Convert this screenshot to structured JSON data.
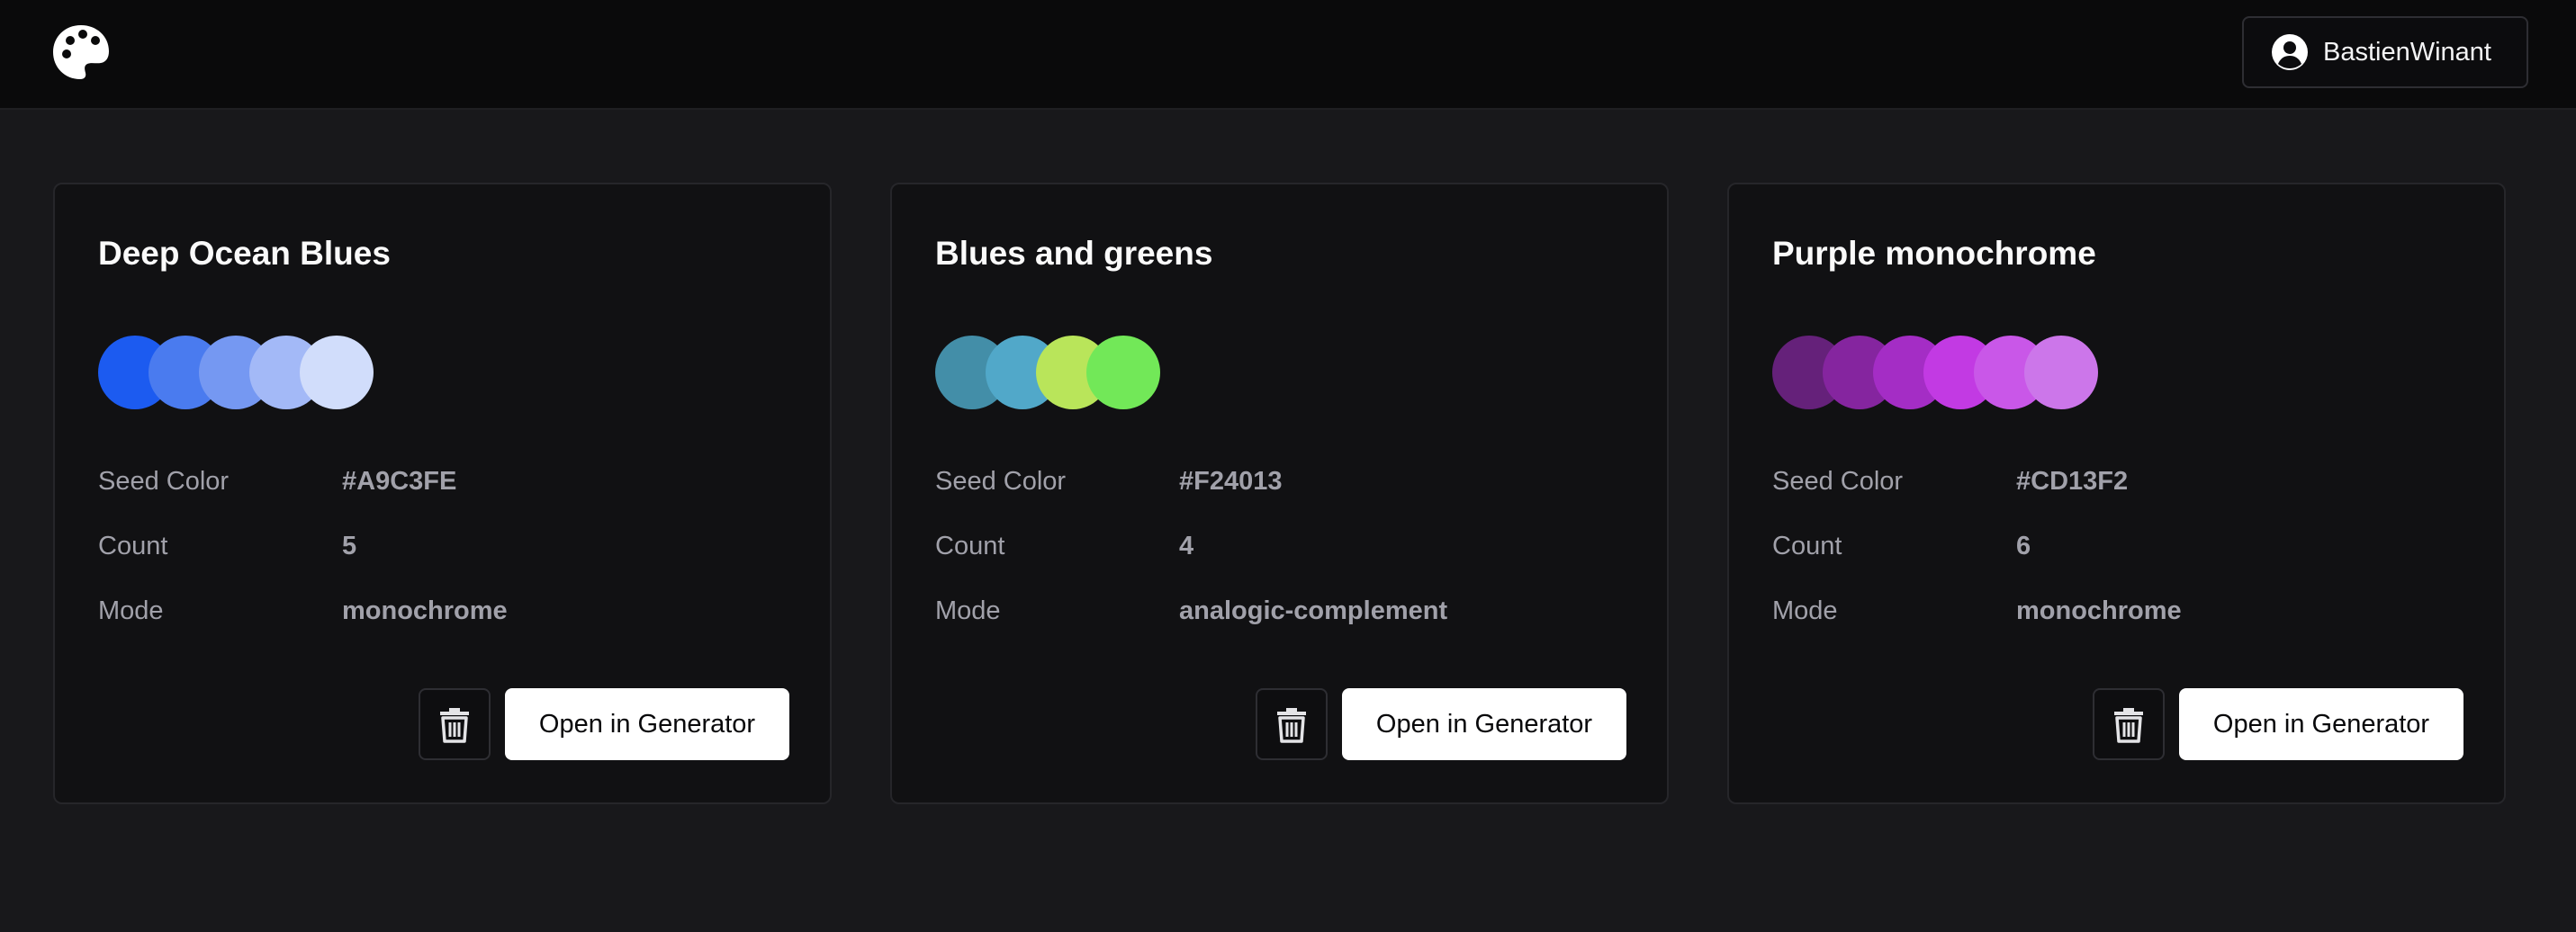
{
  "header": {
    "logo_icon": "palette-icon",
    "user_icon": "user-circle-icon",
    "username": "BastienWinant"
  },
  "labels": {
    "seed": "Seed Color",
    "count": "Count",
    "mode": "Mode",
    "open_button": "Open in Generator",
    "delete_icon": "trash-icon"
  },
  "palettes": [
    {
      "title": "Deep Ocean Blues",
      "colors": [
        "#1c5bf0",
        "#4a7bef",
        "#7598f2",
        "#a3b9f7",
        "#d1ddfb"
      ],
      "seed": "#A9C3FE",
      "count": "5",
      "mode": "monochrome"
    },
    {
      "title": "Blues and greens",
      "colors": [
        "#438ea8",
        "#51a8c9",
        "#b9e55a",
        "#72e858"
      ],
      "seed": "#F24013",
      "count": "4",
      "mode": "analogic-complement"
    },
    {
      "title": "Purple monochrome",
      "colors": [
        "#65217a",
        "#85259f",
        "#a42dc5",
        "#c23ae3",
        "#c957e8",
        "#cc76ea"
      ],
      "seed": "#CD13F2",
      "count": "6",
      "mode": "monochrome"
    }
  ]
}
